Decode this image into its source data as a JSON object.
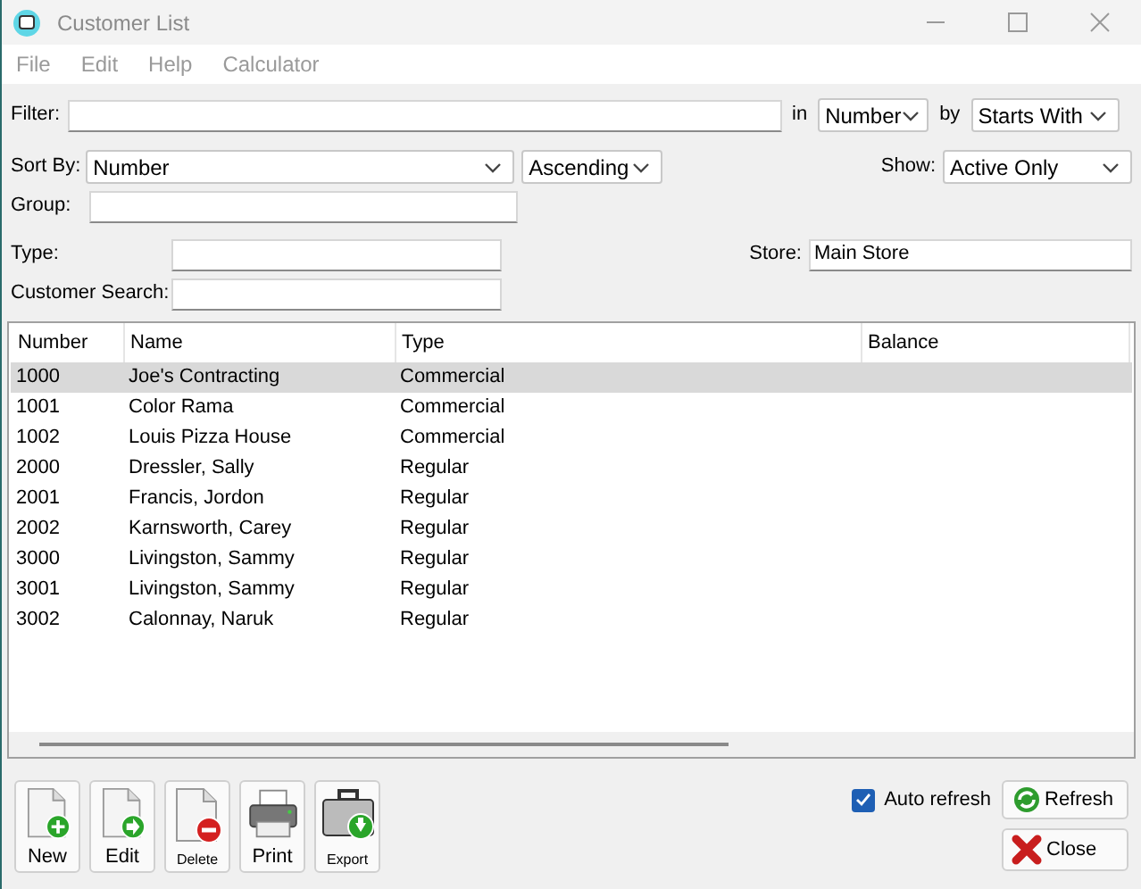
{
  "window": {
    "title": "Customer List"
  },
  "menu": [
    "File",
    "Edit",
    "Help",
    "Calculator"
  ],
  "filter": {
    "label": "Filter:",
    "in_label": "in",
    "in_value": "Number",
    "by_label": "by",
    "by_value": "Starts With"
  },
  "sort": {
    "label": "Sort By:",
    "value": "Number",
    "order": "Ascending",
    "show_label": "Show:",
    "show_value": "Active Only"
  },
  "group": {
    "label": "Group:"
  },
  "type": {
    "label": "Type:"
  },
  "store": {
    "label": "Store:",
    "value": "Main Store"
  },
  "customer_search": {
    "label": "Customer Search:"
  },
  "table": {
    "columns": [
      "Number",
      "Name",
      "Type",
      "Balance"
    ],
    "rows": [
      {
        "number": "1000",
        "name": "Joe's Contracting",
        "type": "Commercial",
        "selected": true
      },
      {
        "number": "1001",
        "name": "Color Rama",
        "type": "Commercial",
        "selected": false
      },
      {
        "number": "1002",
        "name": "Louis Pizza House",
        "type": "Commercial",
        "selected": false
      },
      {
        "number": "2000",
        "name": "Dressler, Sally",
        "type": "Regular",
        "selected": false
      },
      {
        "number": "2001",
        "name": "Francis, Jordon",
        "type": "Regular",
        "selected": false
      },
      {
        "number": "2002",
        "name": "Karnsworth, Carey",
        "type": "Regular",
        "selected": false
      },
      {
        "number": "3000",
        "name": "Livingston, Sammy",
        "type": "Regular",
        "selected": false
      },
      {
        "number": "3001",
        "name": "Livingston, Sammy",
        "type": "Regular",
        "selected": false
      },
      {
        "number": "3002",
        "name": "Calonnay, Naruk",
        "type": "Regular",
        "selected": false
      }
    ]
  },
  "toolbar": [
    {
      "kind": "new",
      "label": "New"
    },
    {
      "kind": "edit",
      "label": "Edit"
    },
    {
      "kind": "delete",
      "label": "Delete"
    },
    {
      "kind": "print",
      "label": "Print"
    },
    {
      "kind": "export",
      "label": "Export"
    }
  ],
  "auto_refresh": {
    "label": "Auto refresh",
    "checked": true
  },
  "buttons": [
    {
      "kind": "refresh",
      "label": "Refresh"
    },
    {
      "kind": "close",
      "label": "Close"
    }
  ]
}
